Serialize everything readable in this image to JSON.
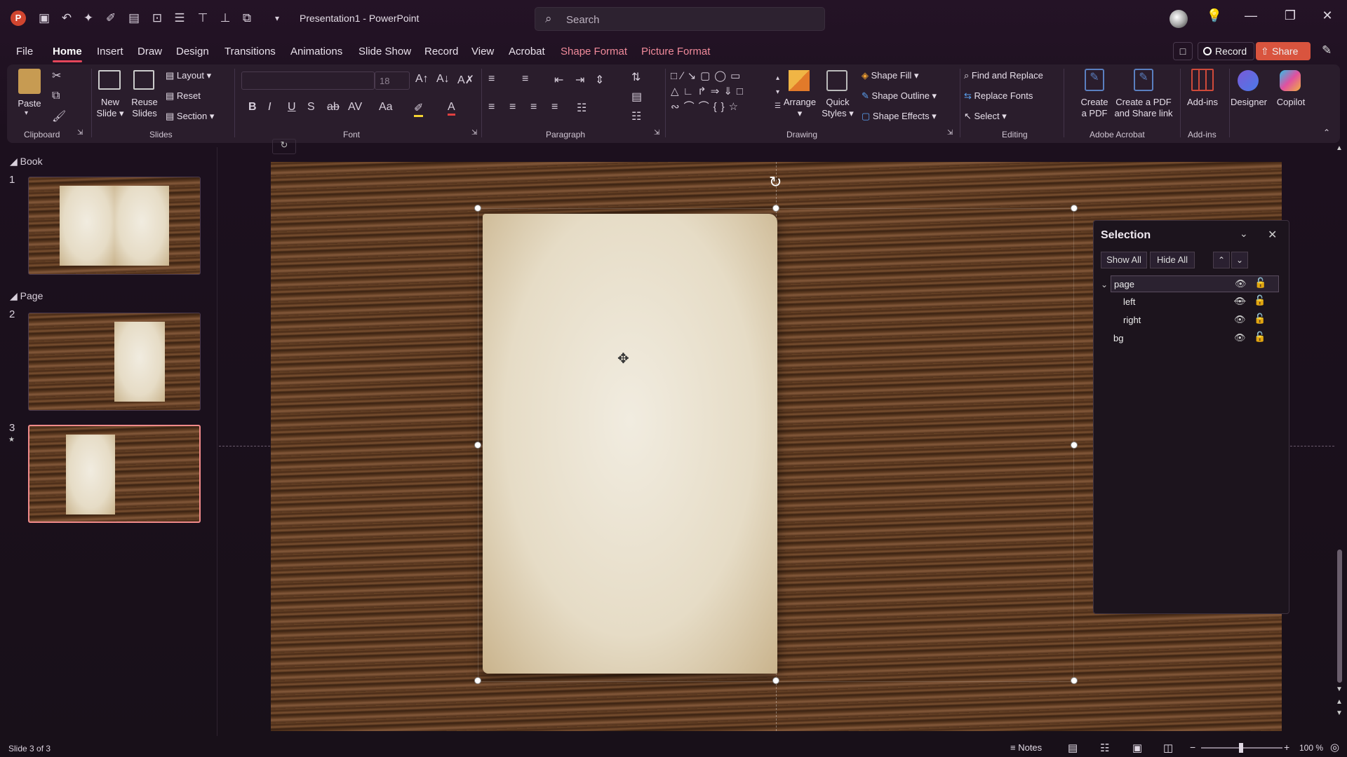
{
  "app": {
    "title": "Presentation1  -  PowerPoint",
    "search_placeholder": "Search"
  },
  "quick_access": [
    "save-icon",
    "undo-icon",
    "redo-icon",
    "pen-icon",
    "align-icon",
    "crop-icon",
    "distribute-icon",
    "align-top-icon",
    "align-bottom-icon",
    "group-icon",
    "customize-icon"
  ],
  "tabs": [
    "File",
    "Home",
    "Insert",
    "Draw",
    "Design",
    "Transitions",
    "Animations",
    "Slide Show",
    "Record",
    "View",
    "Acrobat"
  ],
  "context_tabs": [
    "Shape Format",
    "Picture Format"
  ],
  "right_buttons": {
    "record": "Record",
    "share": "Share"
  },
  "ribbon": {
    "clipboard": {
      "label": "Clipboard",
      "paste": "Paste"
    },
    "slides": {
      "label": "Slides",
      "new_slide": "New",
      "new_slide2": "Slide",
      "reuse": "Reuse",
      "reuse2": "Slides",
      "layout": "Layout",
      "reset": "Reset",
      "section": "Section"
    },
    "font": {
      "label": "Font",
      "size": "18"
    },
    "paragraph": {
      "label": "Paragraph"
    },
    "drawing": {
      "label": "Drawing",
      "arrange": "Arrange",
      "quick": "Quick",
      "quick2": "Styles",
      "fill": "Shape Fill",
      "outline": "Shape Outline",
      "effects": "Shape Effects"
    },
    "editing": {
      "label": "Editing",
      "find": "Find and Replace",
      "replace_fonts": "Replace Fonts",
      "select": "Select"
    },
    "acrobat": {
      "label": "Adobe Acrobat",
      "create": "Create",
      "create2": "a PDF",
      "share": "Create a PDF",
      "share2": "and Share link"
    },
    "addins": {
      "label": "Add-ins",
      "addins": "Add-ins"
    },
    "designer": "Designer",
    "copilot": "Copilot"
  },
  "thumbnails": {
    "sections": [
      "Book",
      "Page"
    ],
    "nums": [
      "1",
      "2",
      "3"
    ]
  },
  "selection_pane": {
    "title": "Selection",
    "show_all": "Show All",
    "hide_all": "Hide All",
    "items": [
      "page",
      "left",
      "right",
      "bg"
    ]
  },
  "status": {
    "slide": "Slide 3 of 3",
    "notes": "Notes",
    "zoom": "100 %"
  },
  "colors": {
    "accent": "#e4465a",
    "ribbon_bg": "#2a1d2c",
    "window_bg": "#1c101e"
  }
}
